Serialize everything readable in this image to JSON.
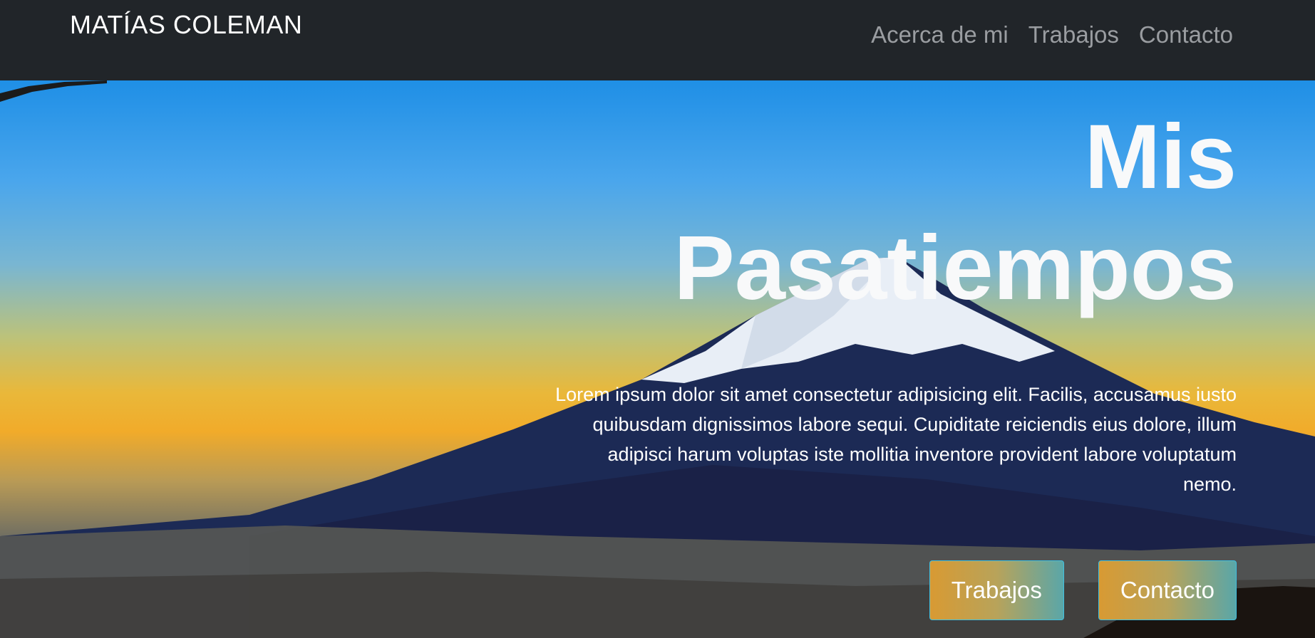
{
  "navbar": {
    "brand": "MATÍAS COLEMAN",
    "links": [
      "Acerca de mi",
      "Trabajos",
      "Contacto"
    ]
  },
  "hero": {
    "title_line1": "Mis",
    "title_line2": "Pasatiempos",
    "text": "Lorem ipsum dolor sit amet consectetur adipisicing elit. Facilis, accusamus iusto quibusdam dignissimos labore sequi. Cupiditate reiciendis eius dolore, illum adipisci harum voluptas iste mollitia inventore provident labore voluptatum nemo.",
    "buttons": [
      "Trabajos",
      "Contacto"
    ]
  },
  "colors": {
    "navbar_bg": "#212529",
    "sky_top": "#1f8fe6",
    "horizon": "#f1ab2a"
  },
  "image": "mount-fuji-landscape-photo"
}
